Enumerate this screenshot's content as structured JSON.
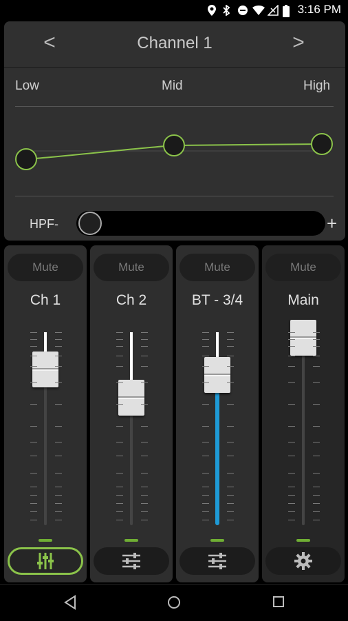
{
  "status_bar": {
    "time": "3:16 PM"
  },
  "channel_header": {
    "prev_label": "<",
    "title": "Channel 1",
    "next_label": ">"
  },
  "eq": {
    "bands": [
      "Low",
      "Mid",
      "High"
    ],
    "hpf_label": "HPF-",
    "hpf_plus": "+"
  },
  "strips": [
    {
      "mute_label": "Mute",
      "name": "Ch 1",
      "fader_level": 0.82,
      "button_icon": "mixer-sliders-icon",
      "button_active": true,
      "accent": "#8bc34a"
    },
    {
      "mute_label": "Mute",
      "name": "Ch 2",
      "fader_level": 0.7,
      "button_icon": "sliders-icon",
      "button_active": false
    },
    {
      "mute_label": "Mute",
      "name": "BT - 3/4",
      "fader_level": 0.79,
      "button_icon": "sliders-icon",
      "button_active": false,
      "level_color": "#1e9ad6"
    },
    {
      "mute_label": "Mute",
      "name": "Main",
      "fader_level": 0.92,
      "button_icon": "gear-icon",
      "button_active": false
    }
  ],
  "colors": {
    "accent_green": "#8bc34a",
    "meter_blue": "#1e9ad6",
    "panel": "#303030"
  },
  "nav_bar": {
    "icons": [
      "back-icon",
      "home-icon",
      "recents-icon"
    ]
  }
}
